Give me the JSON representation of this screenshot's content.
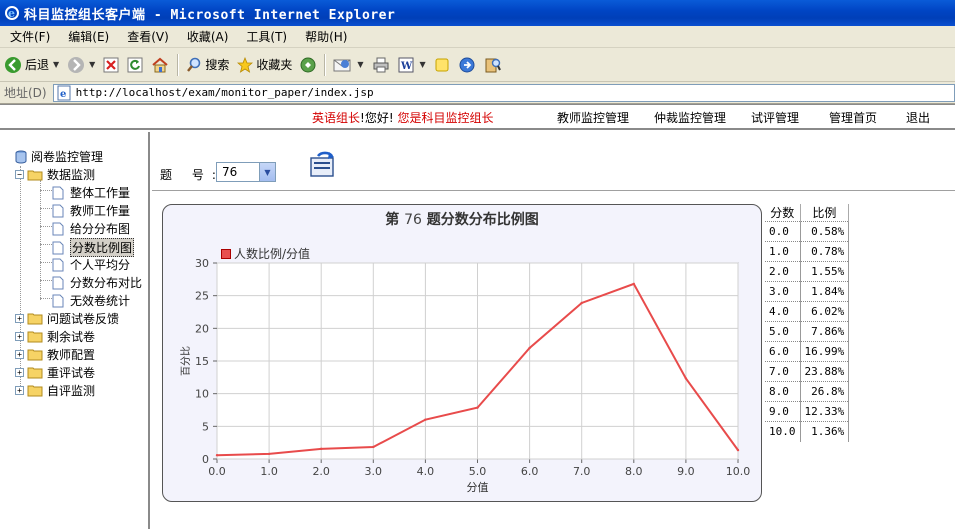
{
  "window": {
    "title": "科目监控组长客户端 - Microsoft Internet Explorer"
  },
  "menu": [
    "文件(F)",
    "编辑(E)",
    "查看(V)",
    "收藏(A)",
    "工具(T)",
    "帮助(H)"
  ],
  "toolbar": {
    "back_label": "后退",
    "search_label": "搜索",
    "favorites_label": "收藏夹"
  },
  "address": {
    "label": "地址(D)",
    "url": "http://localhost/exam/monitor_paper/index.jsp"
  },
  "topnav": {
    "greet_role": "英语组长",
    "greet_hello": "!您好!",
    "greet_status": "您是科目监控组长",
    "links": [
      "教师监控管理",
      "仲裁监控管理",
      "试评管理",
      "管理首页",
      "退出"
    ]
  },
  "tree": {
    "root": "阅卷监控管理",
    "data_monitor": "数据监测",
    "children": [
      "整体工作量",
      "教师工作量",
      "给分分布图",
      "分数比例图",
      "个人平均分",
      "分数分布对比",
      "无效卷统计"
    ],
    "selected_index": 3,
    "folders": [
      "问题试卷反馈",
      "剩余试卷",
      "教师配置",
      "重评试卷",
      "自评监测"
    ]
  },
  "question": {
    "label": "题 号:",
    "value": "76"
  },
  "chart_title": {
    "prefix": "第",
    "number": "76",
    "suffix": "题分数分布比例图"
  },
  "table": {
    "headers": [
      "分数",
      "比例"
    ],
    "rows": [
      [
        "0.0",
        "0.58%"
      ],
      [
        "1.0",
        "0.78%"
      ],
      [
        "2.0",
        "1.55%"
      ],
      [
        "3.0",
        "1.84%"
      ],
      [
        "4.0",
        "6.02%"
      ],
      [
        "5.0",
        "7.86%"
      ],
      [
        "6.0",
        "16.99%"
      ],
      [
        "7.0",
        "23.88%"
      ],
      [
        "8.0",
        "26.8%"
      ],
      [
        "9.0",
        "12.33%"
      ],
      [
        "10.0",
        "1.36%"
      ]
    ]
  },
  "colors": {
    "line": "#e84b4b",
    "title_bar": "#0045c4",
    "highlight_red": "#d40000"
  },
  "chart_data": {
    "type": "line",
    "title": "",
    "xlabel": "分值",
    "ylabel": "百分比",
    "x": [
      0,
      1,
      2,
      3,
      4,
      5,
      6,
      7,
      8,
      9,
      10
    ],
    "series": [
      {
        "name": "人数比例/分值",
        "values": [
          0.58,
          0.78,
          1.55,
          1.84,
          6.02,
          7.86,
          16.99,
          23.88,
          26.8,
          12.33,
          1.36
        ]
      }
    ],
    "xlim": [
      0,
      10
    ],
    "ylim": [
      0,
      30
    ],
    "xticks": [
      "0.0",
      "1.0",
      "2.0",
      "3.0",
      "4.0",
      "5.0",
      "6.0",
      "7.0",
      "8.0",
      "9.0",
      "10.0"
    ],
    "yticks": [
      "0",
      "5",
      "10",
      "15",
      "20",
      "25",
      "30"
    ],
    "grid": true,
    "legend": "top-left"
  }
}
